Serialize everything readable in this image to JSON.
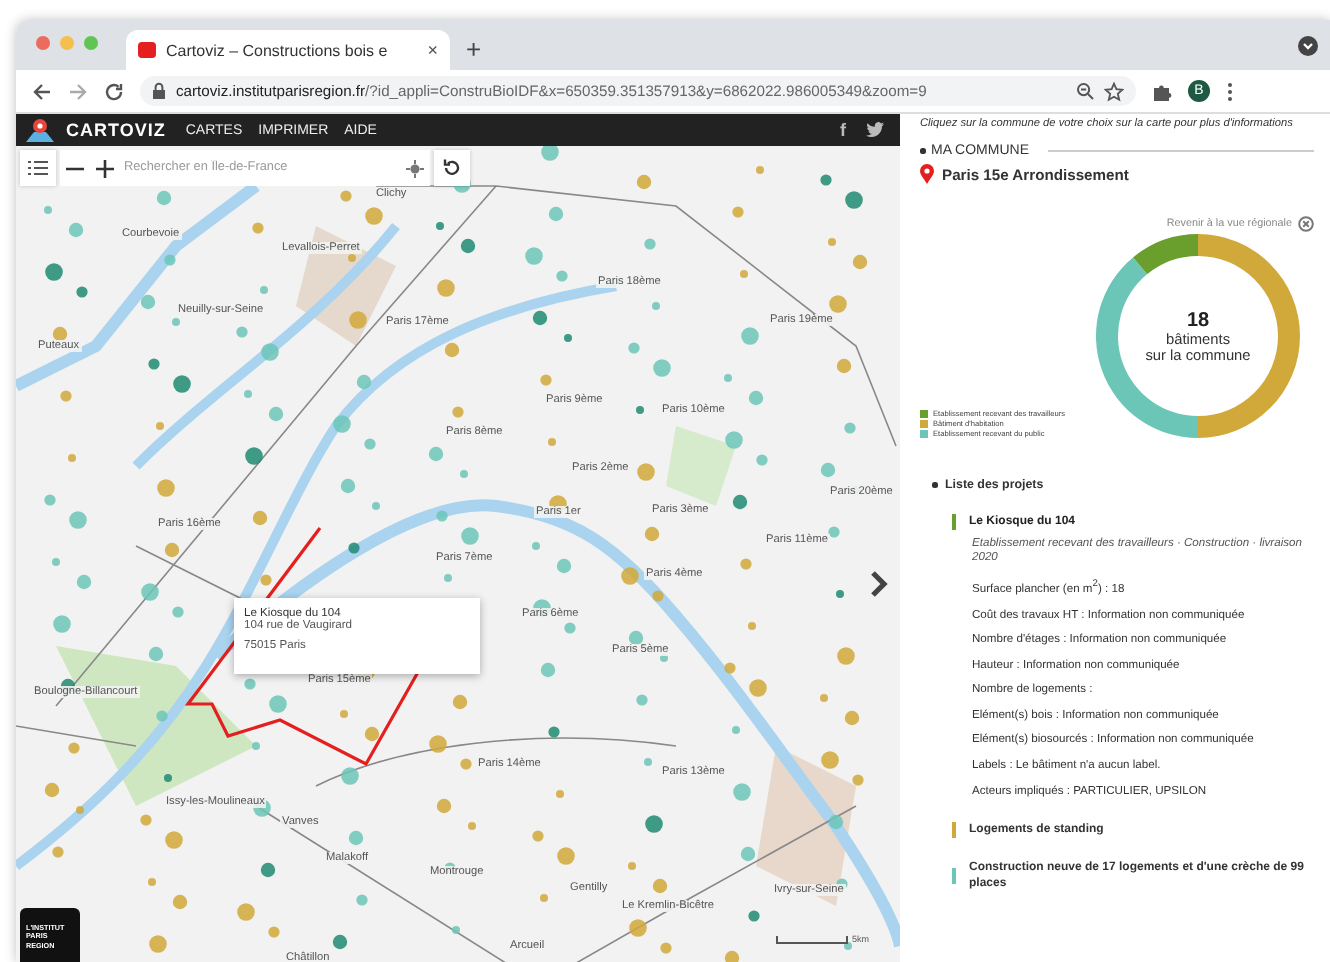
{
  "browser": {
    "tab_title": "Cartoviz – Constructions bois e",
    "tab_close": "×",
    "new_tab": "+",
    "url_host": "cartoviz.institutparisregion.fr",
    "url_path": "/?id_appli=ConstruBioIDF&x=650359.351357913&y=6862022.986005349&zoom=9",
    "avatar": "B"
  },
  "app_bar": {
    "logo": "CARTOVIZ",
    "menu": [
      "CARTES",
      "IMPRIMER",
      "AIDE"
    ],
    "social": [
      "f"
    ]
  },
  "map": {
    "search": {
      "placeholder": "Rechercher en Île-de-France"
    },
    "labels": [
      "Clichy",
      "Courbevoie",
      "Levallois-Perret",
      "Neuilly-sur-Seine",
      "Puteaux",
      "Paris 17ème",
      "Paris 18ème",
      "Paris 19ème",
      "Paris 9ème",
      "Paris 10ème",
      "Paris 8ème",
      "Paris 2ème",
      "Paris 1er",
      "Paris 3ème",
      "Paris 20ème",
      "Paris 11ème",
      "Paris 16ème",
      "Paris 7ème",
      "Paris 4ème",
      "Paris 6ème",
      "Paris 5ème",
      "Paris 15ème",
      "Boulogne-Billancourt",
      "Paris 14ème",
      "Paris 13ème",
      "Issy-les-Moulineaux",
      "Vanves",
      "Malakoff",
      "Montrouge",
      "Gentilly",
      "Le Kremlin-Bicêtre",
      "Ivry-sur-Seine",
      "Arcueil",
      "Châtillon"
    ],
    "popup": {
      "title": "Le Kiosque du 104",
      "address": "104 rue de Vaugirard",
      "city": "75015 Paris"
    },
    "logo_lines": [
      "L'INSTITUT",
      "PARIS",
      "REGION"
    ],
    "scale": "5km"
  },
  "panel": {
    "hint": "Cliquez sur la commune de votre choix sur la carte pour plus d'informations",
    "section": "MA COMMUNE",
    "commune": "Paris 15e Arrondissement",
    "back_link": "Revenir à la vue régionale",
    "donut_center": {
      "count": "18",
      "line1": "bâtiments",
      "line2": "sur la commune"
    },
    "chart_data": {
      "type": "donut",
      "values": [
        11,
        50,
        39
      ]
    },
    "legend": [
      {
        "label": "Etablissement recevant des travailleurs",
        "color": "#6a9f2e"
      },
      {
        "label": "Bâtiment d'habitation",
        "color": "#d1a83a"
      },
      {
        "label": "Etablissement recevant du public",
        "color": "#6cc6b8"
      }
    ],
    "list_title": "Liste des projets",
    "projects": [
      {
        "title": "Le Kiosque du 104",
        "color": "#6a9f2e",
        "expanded": true,
        "subtitle": "Etablissement recevant des travailleurs · Construction · livraison 2020",
        "details": [
          "Surface plancher (en m$^{2}$) : 18",
          "Coût des travaux HT : Information non communiquée",
          "Nombre d'étages : Information non communiquée",
          "Hauteur : Information non communiquée",
          "Nombre de logements :",
          "Elément(s) bois : Information non communiquée",
          "Elément(s) biosourcés : Information non communiquée",
          "Labels : Le bâtiment n'a aucun label.",
          "Acteurs impliqués : PARTICULIER, UPSILON"
        ]
      },
      {
        "title": "Logements de standing",
        "color": "#d1a83a",
        "expanded": false
      },
      {
        "title": "Construction neuve de 17 logements et d'une crèche de 99 places",
        "color": "#6cc6b8",
        "expanded": false
      }
    ]
  }
}
